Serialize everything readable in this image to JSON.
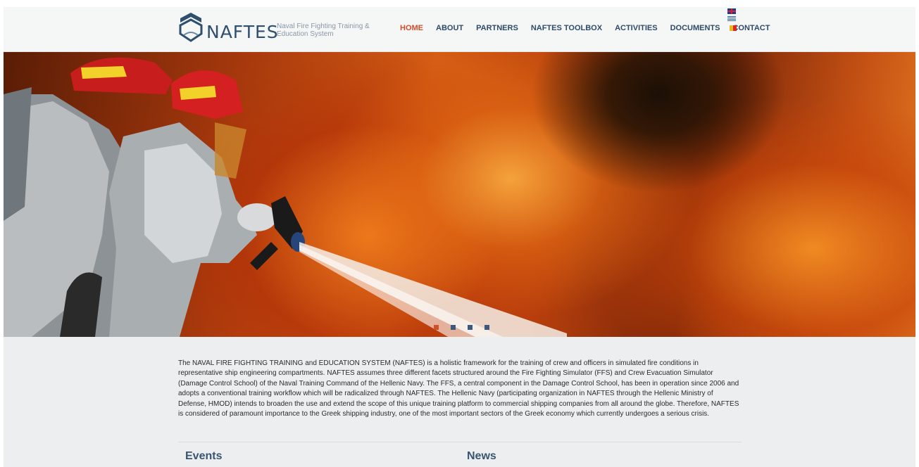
{
  "header": {
    "logo_text": "NAFTES",
    "logo_tagline": "Naval Fire Fighting Training & Education System",
    "nav": [
      {
        "label": "HOME",
        "active": true
      },
      {
        "label": "ABOUT",
        "active": false
      },
      {
        "label": "PARTNERS",
        "active": false
      },
      {
        "label": "NAFTES TOOLBOX",
        "active": false
      },
      {
        "label": "ACTIVITIES",
        "active": false
      },
      {
        "label": "DOCUMENTS",
        "active": false
      },
      {
        "label": "CONTACT",
        "active": false
      }
    ],
    "flags": [
      "uk-flag-icon",
      "greece-flag-icon",
      "italy-flag-icon"
    ]
  },
  "hero": {
    "slides_count": 4,
    "active_slide": 1
  },
  "intro": {
    "text": "The NAVAL FIRE FIGHTING TRAINING and EDUCATION SYSTEM (NAFTES) is a holistic framework for the training of crew and officers in simulated fire conditions in representative ship engineering compartments. NAFTES assumes three different facets structured around the Fire Fighting Simulator (FFS) and Crew Evacuation Simulator (Damage Control School) of the Naval Training Command of the Hellenic Navy. The FFS, a central component in the Damage Control School, has been in operation since 2006 and adopts a conventional training workflow which will be radicalized through NAFTES. The Hellenic Navy (participating organization in NAFTES through the Hellenic Ministry of Defense, HMOD) intends to broaden the use and extend the scope of this unique training platform to commercial shipping companies from all around the globe. Therefore, NAFTES is considered of paramount importance to the Greek shipping industry, one of the most important sectors of the Greek economy which currently undergoes a serious crisis."
  },
  "sections": {
    "events_title": "Events",
    "news_title": "News"
  },
  "colors": {
    "accent": "#d0502a",
    "nav_text": "#2e4a68",
    "logo": "#2e4f6e"
  }
}
